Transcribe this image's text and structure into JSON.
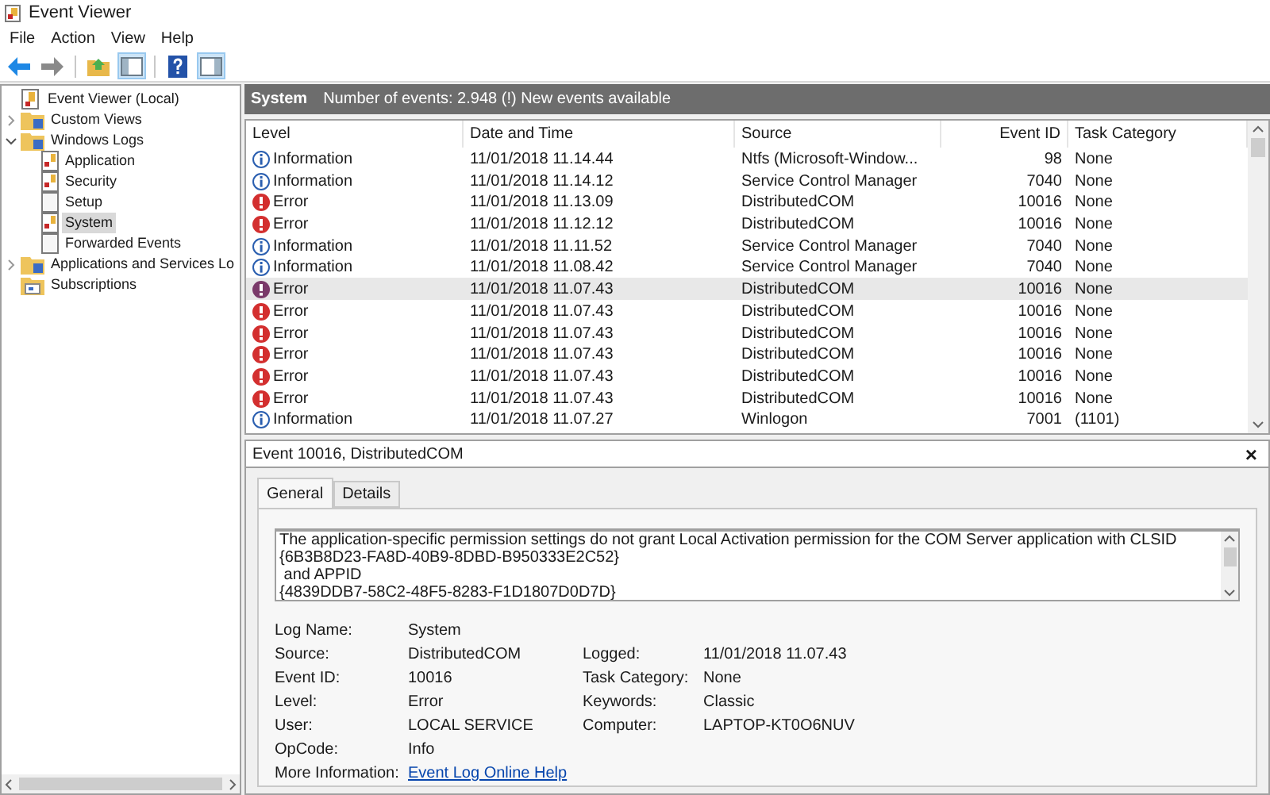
{
  "window": {
    "title": "Event Viewer"
  },
  "menu": [
    "File",
    "Action",
    "View",
    "Help"
  ],
  "toolbar": [
    {
      "kind": "back",
      "pressed": false
    },
    {
      "kind": "forward",
      "pressed": false
    },
    {
      "kind": "up",
      "pressed": false
    },
    {
      "kind": "tree",
      "pressed": true
    },
    {
      "kind": "help",
      "pressed": false
    },
    {
      "kind": "pane",
      "pressed": true
    }
  ],
  "tree": [
    {
      "label": "Event Viewer (Local)",
      "kind": "root",
      "selected": false
    },
    {
      "label": "Custom Views",
      "kind": "folder",
      "expanded": false,
      "selected": false
    },
    {
      "label": "Windows Logs",
      "kind": "folder",
      "expanded": true,
      "selected": false,
      "children": [
        {
          "label": "Application",
          "kind": "log",
          "selected": false
        },
        {
          "label": "Security",
          "kind": "log",
          "selected": false
        },
        {
          "label": "Setup",
          "kind": "plain",
          "selected": false
        },
        {
          "label": "System",
          "kind": "log",
          "selected": true
        },
        {
          "label": "Forwarded Events",
          "kind": "plain",
          "selected": false
        }
      ]
    },
    {
      "label": "Applications and Services Lo",
      "kind": "folder",
      "expanded": false,
      "selected": false
    },
    {
      "label": "Subscriptions",
      "kind": "subs",
      "selected": false
    }
  ],
  "log_header": {
    "name": "System",
    "info": "Number of events: 2.948 (!) New events available"
  },
  "table": {
    "columns": [
      "Level",
      "Date and Time",
      "Source",
      "Event ID",
      "Task Category"
    ],
    "rows": [
      {
        "kind": "information",
        "level": "Information",
        "date": "11/01/2018 11.14.44",
        "source": "Ntfs (Microsoft-Window...",
        "id": "98",
        "category": "None",
        "selected": false
      },
      {
        "kind": "information",
        "level": "Information",
        "date": "11/01/2018 11.14.12",
        "source": "Service Control Manager",
        "id": "7040",
        "category": "None",
        "selected": false
      },
      {
        "kind": "error",
        "level": "Error",
        "date": "11/01/2018 11.13.09",
        "source": "DistributedCOM",
        "id": "10016",
        "category": "None",
        "selected": false
      },
      {
        "kind": "error",
        "level": "Error",
        "date": "11/01/2018 11.12.12",
        "source": "DistributedCOM",
        "id": "10016",
        "category": "None",
        "selected": false
      },
      {
        "kind": "information",
        "level": "Information",
        "date": "11/01/2018 11.11.52",
        "source": "Service Control Manager",
        "id": "7040",
        "category": "None",
        "selected": false
      },
      {
        "kind": "information",
        "level": "Information",
        "date": "11/01/2018 11.08.42",
        "source": "Service Control Manager",
        "id": "7040",
        "category": "None",
        "selected": false
      },
      {
        "kind": "error",
        "level": "Error",
        "date": "11/01/2018 11.07.43",
        "source": "DistributedCOM",
        "id": "10016",
        "category": "None",
        "selected": true
      },
      {
        "kind": "error",
        "level": "Error",
        "date": "11/01/2018 11.07.43",
        "source": "DistributedCOM",
        "id": "10016",
        "category": "None",
        "selected": false
      },
      {
        "kind": "error",
        "level": "Error",
        "date": "11/01/2018 11.07.43",
        "source": "DistributedCOM",
        "id": "10016",
        "category": "None",
        "selected": false
      },
      {
        "kind": "error",
        "level": "Error",
        "date": "11/01/2018 11.07.43",
        "source": "DistributedCOM",
        "id": "10016",
        "category": "None",
        "selected": false
      },
      {
        "kind": "error",
        "level": "Error",
        "date": "11/01/2018 11.07.43",
        "source": "DistributedCOM",
        "id": "10016",
        "category": "None",
        "selected": false
      },
      {
        "kind": "error",
        "level": "Error",
        "date": "11/01/2018 11.07.43",
        "source": "DistributedCOM",
        "id": "10016",
        "category": "None",
        "selected": false
      },
      {
        "kind": "information",
        "level": "Information",
        "date": "11/01/2018 11.07.27",
        "source": "Winlogon",
        "id": "7001",
        "category": "(1101)",
        "selected": false
      }
    ]
  },
  "detail": {
    "title": "Event 10016, DistributedCOM",
    "close": "×",
    "tabs": [
      {
        "label": "General",
        "selected": true
      },
      {
        "label": "Details",
        "selected": false
      }
    ],
    "description": [
      "The application-specific permission settings do not grant Local Activation permission for the COM Server application with CLSID",
      "{6B3B8D23-FA8D-40B9-8DBD-B950333E2C52}",
      " and APPID",
      "{4839DDB7-58C2-48F5-8283-F1D1807D0D7D}"
    ],
    "fields_left": [
      {
        "label": "Log Name:",
        "value": "System"
      },
      {
        "label": "Source:",
        "value": "DistributedCOM"
      },
      {
        "label": "Event ID:",
        "value": "10016"
      },
      {
        "label": "Level:",
        "value": "Error"
      },
      {
        "label": "User:",
        "value": "LOCAL SERVICE"
      },
      {
        "label": "OpCode:",
        "value": "Info"
      },
      {
        "label": "More Information:",
        "value": "Event Log Online Help",
        "kind": "link"
      }
    ],
    "fields_right": [
      {
        "label": "Logged:",
        "value": "11/01/2018 11.07.43"
      },
      {
        "label": "Task Category:",
        "value": "None"
      },
      {
        "label": "Keywords:",
        "value": "Classic"
      },
      {
        "label": "Computer:",
        "value": "LAPTOP-KT0O6NUV"
      }
    ]
  }
}
